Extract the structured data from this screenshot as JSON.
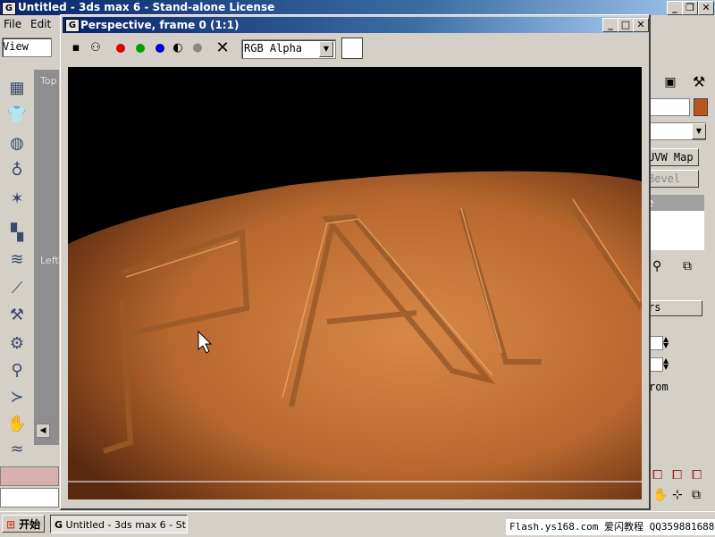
{
  "app": {
    "title": "Untitled - 3ds max 6 - Stand-alone License",
    "icon_name": "3dsmax-app-icon"
  },
  "menu": {
    "file": "File",
    "edit": "Edit"
  },
  "main_toolbar": {
    "view_combo": "View"
  },
  "viewports": {
    "top_label": "Top",
    "left_label": "Left"
  },
  "right_panel": {
    "uvw_map_label": "UVW Map",
    "bevel_label": "Bevel",
    "list_item": "e",
    "rollout_label": "rs",
    "from_label": "rom",
    "swatch_color": "#b8561e"
  },
  "render_window": {
    "title": "Perspective, frame 0 (1:1)",
    "channel_combo": "RGB Alpha",
    "channel_colors": {
      "red": "#e00000",
      "green": "#00a000",
      "blue": "#0000d0"
    }
  },
  "taskbar": {
    "start_label": "开始",
    "task_label": "Untitled - 3ds max 6 - St..."
  },
  "watermark": {
    "text": "Flash.ys168.com 爱闪教程 QQ359881688"
  },
  "scene": {
    "letters": "FAN",
    "object_color": "#c8773c"
  }
}
